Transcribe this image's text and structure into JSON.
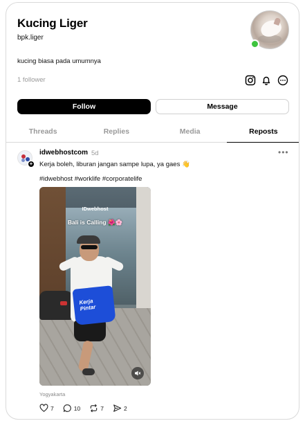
{
  "profile": {
    "name": "Kucing Liger",
    "handle": "bpk.liger",
    "bio": "kucing biasa pada umumnya",
    "followers": "1 follower",
    "online_color": "#3ec43e"
  },
  "header_icons": [
    "instagram-icon",
    "bell-icon",
    "more-circle-icon"
  ],
  "buttons": {
    "follow": "Follow",
    "message": "Message"
  },
  "tabs": [
    {
      "label": "Threads",
      "active": false
    },
    {
      "label": "Replies",
      "active": false
    },
    {
      "label": "Media",
      "active": false
    },
    {
      "label": "Reposts",
      "active": true
    }
  ],
  "post": {
    "author": "idwebhostcom",
    "time": "5d",
    "text": "Kerja boleh, liburan jangan sampe lupa, ya gaes 👋",
    "tags": "#idwebhost #worklife #corporatelife",
    "media": {
      "brand": "IDwebhost",
      "caption": "Bali is Calling 🌺🌸",
      "bag_text": "Kerja Pintar"
    },
    "location": "Yogyakarta",
    "actions": {
      "likes": "7",
      "comments": "10",
      "reposts": "7",
      "shares": "2"
    }
  }
}
